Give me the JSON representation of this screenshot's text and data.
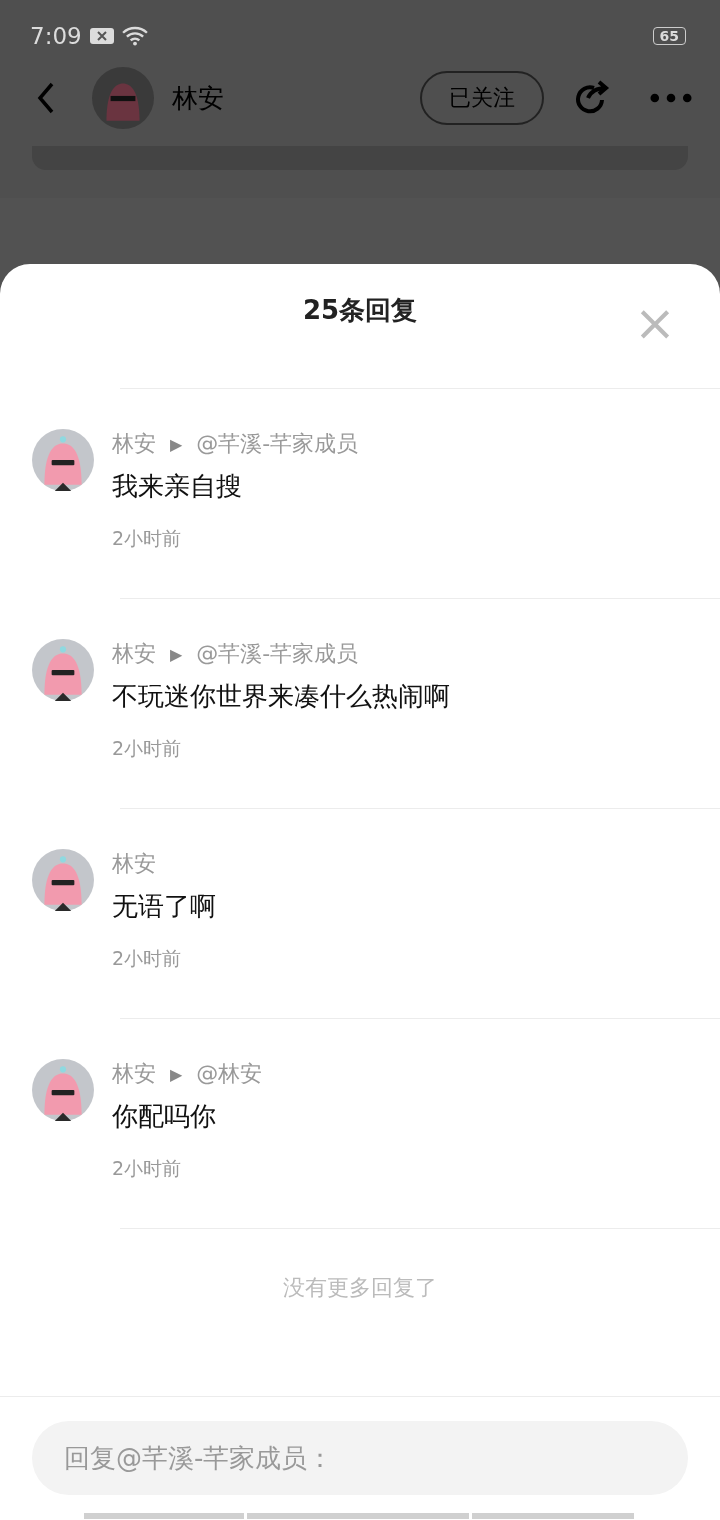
{
  "status_bar": {
    "time": "7:09",
    "battery": "65"
  },
  "header": {
    "name": "林安",
    "follow_button": "已关注"
  },
  "sheet": {
    "title": "25条回复",
    "close": "×",
    "replies": [
      {
        "author": "林安",
        "arrow": "▶",
        "target": "@芊溪-芊家成员",
        "text": "我来亲自搜",
        "time": "2小时前"
      },
      {
        "author": "林安",
        "arrow": "▶",
        "target": "@芊溪-芊家成员",
        "text": "不玩迷你世界来凑什么热闹啊",
        "time": "2小时前"
      },
      {
        "author": "林安",
        "text": "无语了啊",
        "time": "2小时前"
      },
      {
        "author": "林安",
        "arrow": "▶",
        "target": "@林安",
        "text": "你配吗你",
        "time": "2小时前"
      }
    ],
    "end_note": "没有更多回复了",
    "reply_field": {
      "placeholder": "回复@芊溪-芊家成员："
    }
  }
}
